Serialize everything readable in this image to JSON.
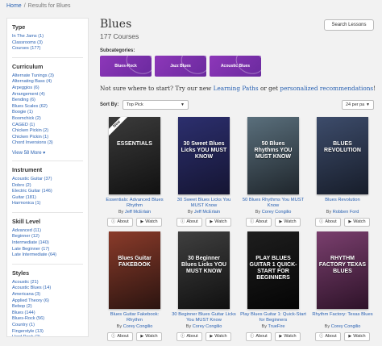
{
  "breadcrumb": {
    "home": "Home",
    "separator": "/",
    "current": "Results for Blues"
  },
  "sidebar": {
    "sections": [
      {
        "title": "Type",
        "items": [
          "In The Jams (1)",
          "Classrooms (3)",
          "Courses (177)"
        ]
      },
      {
        "title": "Curriculum",
        "items": [
          "Alternate Tunings (3)",
          "Alternating Bass (4)",
          "Arpeggios (6)",
          "Arrangement (4)",
          "Bending (6)",
          "Blues Scales (62)",
          "Boogie (1)",
          "Boomchick (2)",
          "CAGED (1)",
          "Chicken Pickin (2)",
          "Chicken Pickin (1)",
          "Chord Inversions (3)"
        ],
        "more": "View 58 More ▾"
      },
      {
        "title": "Instrument",
        "items": [
          "Acoustic Guitar (37)",
          "Dobro (2)",
          "Electric Guitar (146)",
          "Guitar (181)",
          "Harmonica (1)"
        ]
      },
      {
        "title": "Skill Level",
        "items": [
          "Advanced (11)",
          "Beginner (12)",
          "Intermediate (140)",
          "Late Beginner (17)",
          "Late Intermediate (64)"
        ]
      },
      {
        "title": "Styles",
        "items": [
          "Acoustic (21)",
          "Acoustic Blues (14)",
          "Americana (3)",
          "Applied Theory (6)",
          "Bebop (2)",
          "Blues (144)",
          "Blues-Rock (56)",
          "Country (1)",
          "Fingerstyle (13)",
          "Hard Rock (2)",
          "Jazz (10)",
          "Jazz Blues (14)"
        ]
      }
    ]
  },
  "main": {
    "title": "Blues",
    "count": "177 Courses",
    "search_button": "Search Lessons",
    "subcategories_label": "Subcategories:",
    "subcategories": [
      "Blues-Rock",
      "Jazz Blues",
      "Acoustic Blues"
    ],
    "promo": {
      "before": "Not sure where to start? Try our new ",
      "link1": "Learning Paths",
      "middle": " or get ",
      "link2": "personalized recommendations",
      "after": "!"
    },
    "sort_label": "Sort By:",
    "sort_value": "Top Pick",
    "per_page": "24 per pa",
    "about_label": "About",
    "watch_label": "Watch"
  },
  "courses": [
    {
      "title": "Essentials: Advanced Blues Rhythm",
      "author": "Jeff McErlain",
      "ribbon": "New",
      "cover_text": "ESSENTIALS",
      "cover_colors": [
        "#3b3b3b",
        "#111111"
      ]
    },
    {
      "title": "30 Sweet Blues Licks You MUST Know",
      "author": "Jeff McErlain",
      "cover_text": "30 Sweet Blues Licks YOU MUST KNOW",
      "cover_colors": [
        "#2c2f6e",
        "#151533"
      ]
    },
    {
      "title": "50 Blues Rhythms You MUST Know",
      "author": "Corey Congilio",
      "cover_text": "50 Blues Rhythms YOU MUST KNOW",
      "cover_colors": [
        "#5a6f7c",
        "#1f262c"
      ]
    },
    {
      "title": "Blues Revolution",
      "author": "Robben Ford",
      "cover_text": "BLUES REVOLUTION",
      "cover_colors": [
        "#3d4c6b",
        "#171d2a"
      ]
    },
    {
      "title": "Blues Guitar Fakebook: Rhythm",
      "author": "Corey Congilio",
      "cover_text": "Blues Guitar FAKEBOOK",
      "cover_colors": [
        "#8a3b2a",
        "#2b1410"
      ]
    },
    {
      "title": "30 Beginner Blues Guitar Licks You MUST Know",
      "author": "Corey Congilio",
      "cover_text": "30 Beginner Blues Licks YOU MUST KNOW",
      "cover_colors": [
        "#3f3f3f",
        "#101010"
      ]
    },
    {
      "title": "Play Blues Guitar 1: Quick-Start for Beginners",
      "author": "TrueFire",
      "cover_text": "PLAY BLUES GUITAR 1 QUICK-START FOR BEGINNERS",
      "cover_colors": [
        "#1e1e1e",
        "#050505"
      ]
    },
    {
      "title": "Rhythm Factory: Texas Blues",
      "author": "Corey Congilio",
      "cover_text": "RHYTHM FACTORY TEXAS BLUES",
      "cover_colors": [
        "#7a3f6e",
        "#2e1329"
      ]
    }
  ]
}
